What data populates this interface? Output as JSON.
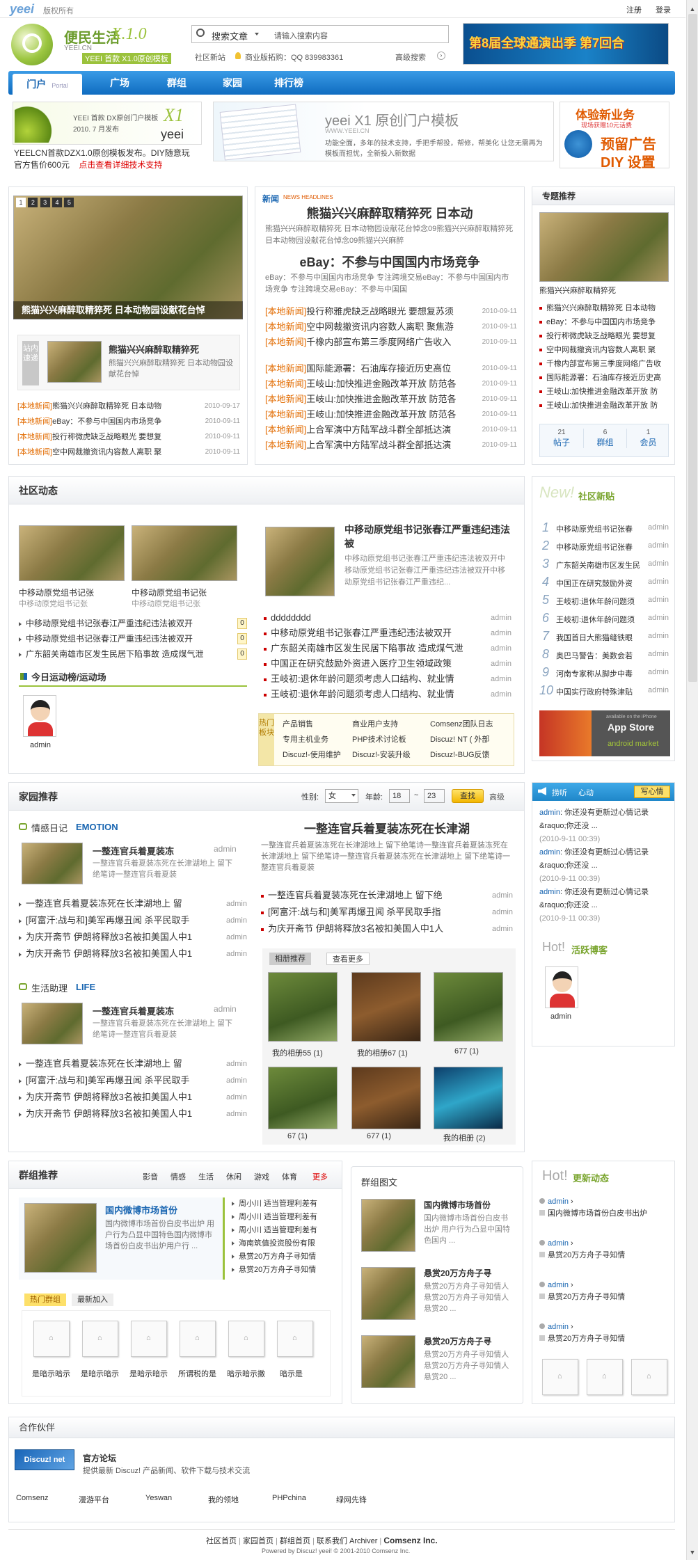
{
  "topbar": {
    "logo": "yeei",
    "copyright": "版权所有",
    "register": "注册",
    "login": "登录"
  },
  "header": {
    "logo_title": "便民生活",
    "logo_sub": "YEEI.CN",
    "version": "X.1.0",
    "slogan": "YEEI 首款 X1.0原创模板",
    "search_type": "搜索文章",
    "search_placeholder": "请输入搜索内容",
    "links": [
      "社区新站",
      "商业版拓购：QQ 839983361",
      "高级搜索"
    ],
    "banner_text": "第8届全球通演出季 第7回合"
  },
  "nav": {
    "tabs": [
      "门户",
      "广场",
      "群组",
      "家园",
      "排行榜"
    ],
    "portal_sub": "Portal"
  },
  "ads": {
    "ad1_l1": "YEEI 首款 DX原创门户模板",
    "ad1_l2": "2010. 7 月发布",
    "ad1_logo": "X1",
    "ad1_yeei": "yeei",
    "ad1_t1": "YEELCN首款DZX1.0原创模板发布。DIY随意玩",
    "ad1_t2": "官方售价600元",
    "ad1_t3": "点击查看详细技术支持",
    "ad2_title": "yeei X1 原创门户模板",
    "ad2_sub": "WWW.YEEI.CN",
    "ad2_desc": "功能全面，多年的技术支持，手把手帮投，帮修，帮美化 让您无需再为模板而担忧，全新投入新数据",
    "ad3_t1": "体验新业务",
    "ad3_t2": "现场获赠10元话费",
    "ad3_t3": "预留广告",
    "ad3_t4": "DIY 设置"
  },
  "slider": {
    "pages": [
      "1",
      "2",
      "3",
      "4",
      "5"
    ],
    "caption": "熊猫兴兴麻醉取精猝死 日本动物园设献花台悼"
  },
  "today": {
    "label": "站内速递",
    "title": "熊猫兴兴麻醉取精猝死",
    "desc": "熊猫兴兴麻醉取精猝死 日本动物园设献花台悼",
    "items": [
      {
        "tag": "[本地新闻]",
        "t": "熊猫兴兴麻醉取精猝死 日本动物",
        "d": "2010-09-17"
      },
      {
        "tag": "[本地新闻]",
        "t": "eBay：不参与中国国内市场竞争",
        "d": "2010-09-11"
      },
      {
        "tag": "[本地新闻]",
        "t": "投行称微虎缺乏战略眼光 要想复",
        "d": "2010-09-11"
      },
      {
        "tag": "[本地新闻]",
        "t": "空中网裁撤资讯内容数人离职 聚",
        "d": "2010-09-11"
      }
    ]
  },
  "headlines": {
    "badge": "新闻",
    "badge2": "NEWS HEADLINES",
    "h1": "熊猫兴兴麻醉取精猝死  日本动",
    "h1_desc": "熊猫兴兴麻醉取精猝死 日本动物园设献花台悼念09熊猫兴兴麻醉取精猝死 日本动物园设献花台悼念09熊猫兴兴麻醉",
    "h2": "eBay：不参与中国国内市场竞争",
    "h2_desc": "eBay：不参与中国国内市场竞争 专注跨境交易eBay：不参与中国国内市场竞争 专注跨境交易eBay：不参与中国国",
    "list1": [
      {
        "tag": "[本地新闻]",
        "t": "投行称雅虎缺乏战略眼光 要想复苏须",
        "d": "2010-09-11"
      },
      {
        "tag": "[本地新闻]",
        "t": "空中网裁撤资讯内容数人离职 聚焦游",
        "d": "2010-09-11"
      },
      {
        "tag": "[本地新闻]",
        "t": "千橡内部宣布第三季度网络广告收入",
        "d": "2010-09-11"
      }
    ],
    "list2": [
      {
        "tag": "[本地新闻]",
        "t": "国际能源署：石油库存接近历史高位",
        "d": "2010-09-11"
      },
      {
        "tag": "[本地新闻]",
        "t": "王岐山:加快推进金融改革开放 防范各",
        "d": "2010-09-11"
      },
      {
        "tag": "[本地新闻]",
        "t": "王岐山:加快推进金融改革开放 防范各",
        "d": "2010-09-11"
      },
      {
        "tag": "[本地新闻]",
        "t": "王岐山:加快推进金融改革开放 防范各",
        "d": "2010-09-11"
      },
      {
        "tag": "[本地新闻]",
        "t": "上合军演中方陆军战斗群全部抵达演",
        "d": "2010-09-11"
      },
      {
        "tag": "[本地新闻]",
        "t": "上合军演中方陆军战斗群全部抵达演",
        "d": "2010-09-11"
      }
    ]
  },
  "special": {
    "title": "专题推荐",
    "caption": "熊猫兴兴麻醉取精猝死",
    "items": [
      "熊猫兴兴麻醉取精猝死 日本动物",
      "eBay：不参与中国国内市场竞争",
      "投行称微虎缺乏战略眼光 要想复",
      "空中网裁撤资讯内容数人离职 聚",
      "千橡内部宣布第三季度网络广告收",
      "国际能源署：石油库存接近历史高",
      "王岐山:加快推进金融改革开放 防",
      "王岐山:加快推进金融改革开放 防"
    ],
    "stats": [
      {
        "n": "21",
        "l": "帖子"
      },
      {
        "n": "6",
        "l": "群组"
      },
      {
        "n": "1",
        "l": "会员"
      }
    ]
  },
  "community": {
    "title": "社区动态",
    "thumbs": [
      {
        "t": "中移动原党组书记张",
        "s": "中移动原党组书记张"
      },
      {
        "t": "中移动原党组书记张",
        "s": "中移动原党组书记张"
      }
    ],
    "hot_list": [
      {
        "t": "中移动原党组书记张春江严重违纪违法被双开",
        "c": "0"
      },
      {
        "t": "中移动原党组书记张春江严重违纪违法被双开",
        "c": "0"
      },
      {
        "t": "广东韶关南雄市区发生民居下陷事故 造成煤气泄",
        "c": "0"
      }
    ],
    "rank_title": "今日运动榜/运动场",
    "rank_user": "admin",
    "feature_title": "中移动原党组书记张春江严重违纪违法被",
    "feature_desc": "中移动原党组书记张春江严重违纪违法被双开中移动原党组书记张春江严重违纪违法被双开中移动原党组书记张春江严重违纪...",
    "feature_list": [
      {
        "t": "dddddddd",
        "a": "admin"
      },
      {
        "t": "中移动原党组书记张春江严重违纪违法被双开",
        "a": "admin"
      },
      {
        "t": "广东韶关南雄市区发生民居下陷事故 造成煤气泄",
        "a": "admin"
      },
      {
        "t": "中国正在研究鼓励外资进入医疗卫生领域政策",
        "a": "admin"
      },
      {
        "t": "王岐初:退休年龄问题须考虑人口结构、就业情",
        "a": "admin"
      },
      {
        "t": "王岐初:退休年龄问题须考虑人口结构、就业情",
        "a": "admin"
      }
    ],
    "hot_label": "热门板块",
    "hot_boards": [
      "产品销售",
      "商业用户支持",
      "Comsenz团队日志",
      "专用主机业务",
      "PHP技术讨论板",
      "Discuz! NT ( 外部",
      "Discuz!-使用维护",
      "Discuz!-安装升级",
      "Discuz!-BUG反馈"
    ]
  },
  "new_posts": {
    "title": "社区新贴",
    "items": [
      {
        "t": "中移动原党组书记张春",
        "a": "admin"
      },
      {
        "t": "中移动原党组书记张春",
        "a": "admin"
      },
      {
        "t": "广东韶关南雄市区发生民",
        "a": "admin"
      },
      {
        "t": "中国正在研究鼓励外资",
        "a": "admin"
      },
      {
        "t": "王岐初:退休年龄问题须",
        "a": "admin"
      },
      {
        "t": "王岐初:退休年龄问题须",
        "a": "admin"
      },
      {
        "t": "我国首日大熊猫缝铁眼",
        "a": "admin"
      },
      {
        "t": "奥巴马警告：美数会若",
        "a": "admin"
      },
      {
        "t": "河南专家称从脚步中毒",
        "a": "admin"
      },
      {
        "t": "中国实行政府特殊津贴",
        "a": "admin"
      }
    ],
    "nums": [
      "1",
      "2",
      "3",
      "4",
      "5",
      "6",
      "7",
      "8",
      "9",
      "10"
    ],
    "app_store": "App Store",
    "android": "android market",
    "app_label": "available on the iPhone"
  },
  "home": {
    "title": "家园推荐",
    "gender_label": "性别:",
    "gender": "女",
    "age_label": "年龄:",
    "age_from": "18",
    "age_sep": "~",
    "age_to": "23",
    "search_btn": "查找",
    "adv": "高级",
    "diary": "情感日记",
    "diary_en": "EMOTION",
    "life": "生活助理",
    "life_en": "LIFE",
    "post_title": "一整连官兵着夏装冻",
    "post_user": "admin",
    "post_desc": "一整连官兵着夏装冻死在长津湖地上 留下绝笔诗一整连官兵着夏装",
    "list": [
      {
        "t": "一整连官兵着夏装冻死在长津湖地上 留",
        "a": "admin"
      },
      {
        "t": "[阿富汗:战与和]美军再爆丑闻 杀平民取手",
        "a": "admin"
      },
      {
        "t": "为庆开斋节 伊朗将释放3名被扣美国人中1",
        "a": "admin"
      },
      {
        "t": "为庆开斋节 伊朗将释放3名被扣美国人中1",
        "a": "admin"
      }
    ],
    "main_title": "一整连官兵着夏装冻死在长津湖",
    "main_desc": "一整连官兵着夏装冻死在长津湖地上 留下绝笔诗一整连官兵着夏装冻死在长津湖地上 留下绝笔诗一整连官兵着夏装冻死在长津湖地上 留下绝笔诗一整连官兵着夏装",
    "main_list": [
      {
        "t": "一整连官兵着夏装冻死在长津湖地上 留下绝",
        "a": "admin"
      },
      {
        "t": "[阿富汗:战与和]美军再爆丑闻 杀平民取手指",
        "a": "admin"
      },
      {
        "t": "为庆开斋节 伊朗将释放3名被扣美国人中1人",
        "a": "admin"
      }
    ],
    "album_tabs": [
      "相册推荐",
      "查看更多"
    ],
    "albums": [
      {
        "l": "我的相册55 (1)"
      },
      {
        "l": "我的相册67 (1)"
      },
      {
        "l": "677 (1)"
      },
      {
        "l": "67 (1)"
      },
      {
        "l": "677 (1)"
      },
      {
        "l": "我的相册 (2)"
      }
    ]
  },
  "mood": {
    "title": "捞听",
    "sub": "心动",
    "btn": "写心情",
    "items": [
      {
        "u": "admin",
        "t": ": 你还没有更新过心情记录 &raquo;你还没 ...",
        "d": "(2010-9-11 00:39)"
      },
      {
        "u": "admin",
        "t": ": 你还没有更新过心情记录 &raquo;你还没 ...",
        "d": "(2010-9-11 00:39)"
      },
      {
        "u": "admin",
        "t": ": 你还没有更新过心情记录 &raquo;你还没 ...",
        "d": "(2010-9-11 00:39)"
      }
    ],
    "hot_blogger": "活跃博客",
    "hot_prefix": "Hot!",
    "blogger": "admin"
  },
  "groups": {
    "title": "群组推荐",
    "tabs": [
      "影音",
      "情感",
      "生活",
      "休闲",
      "游戏",
      "体育",
      "更多"
    ],
    "feat_title": "国内微博市场首份",
    "feat_desc": "国内微博市场首份白皮书出炉 用户行为凸显中国特色国内微博市场首份白皮书出炉用户行 ...",
    "side": [
      "周小川 适当管理利差有",
      "周小川 适当管理利差有",
      "周小川 适当管理利差有",
      "海南筑值投资股份有限",
      "悬赏20万方舟子寻知情",
      "悬赏20万方舟子寻知情"
    ],
    "tabs2": [
      "热门群组",
      "最新加入"
    ],
    "icons": [
      "是暗示暗示",
      "是暗示暗示",
      "是暗示暗示",
      "所谓税的是",
      "暗示暗示撒",
      "暗示是"
    ]
  },
  "group_posts": {
    "title": "群组图文",
    "items": [
      {
        "t": "国内微博市场首份",
        "d": "国内微博市场首份白皮书出炉 用户行为凸显中国特色国内 ..."
      },
      {
        "t": "悬赏20万方舟子寻",
        "d": "悬赏20万方舟子寻知情人悬赏20万方舟子寻知情人悬赏20 ..."
      },
      {
        "t": "悬赏20万方舟子寻",
        "d": "悬赏20万方舟子寻知情人悬赏20万方舟子寻知情人悬赏20 ..."
      }
    ]
  },
  "updates": {
    "prefix": "Hot!",
    "title": "更新动态",
    "items": [
      {
        "u": "admin",
        "t": "国内微博市场首份白皮书出炉"
      },
      {
        "u": "admin",
        "t": "悬赏20万方舟子寻知情"
      },
      {
        "u": "admin",
        "t": "悬赏20万方舟子寻知情"
      },
      {
        "u": "admin",
        "t": "悬赏20万方舟子寻知情"
      }
    ]
  },
  "partners": {
    "title": "合作伙伴",
    "logo": "Discuz! net",
    "name": "官方论坛",
    "desc": "提供最新 Discuz! 产品新闻、软件下载与技术交流",
    "links": [
      "Comsenz",
      "漫游平台",
      "Yeswan",
      "我的领地",
      "PHPchina",
      "绿网先锋"
    ]
  },
  "footer": {
    "links": [
      "社区首页",
      "家园首页",
      "群组首页",
      "联系我们",
      "Archiver"
    ],
    "brand": "Comsenz Inc.",
    "powered": "Powered by Discuz! yeei! © 2001-2010 Comsenz Inc."
  }
}
